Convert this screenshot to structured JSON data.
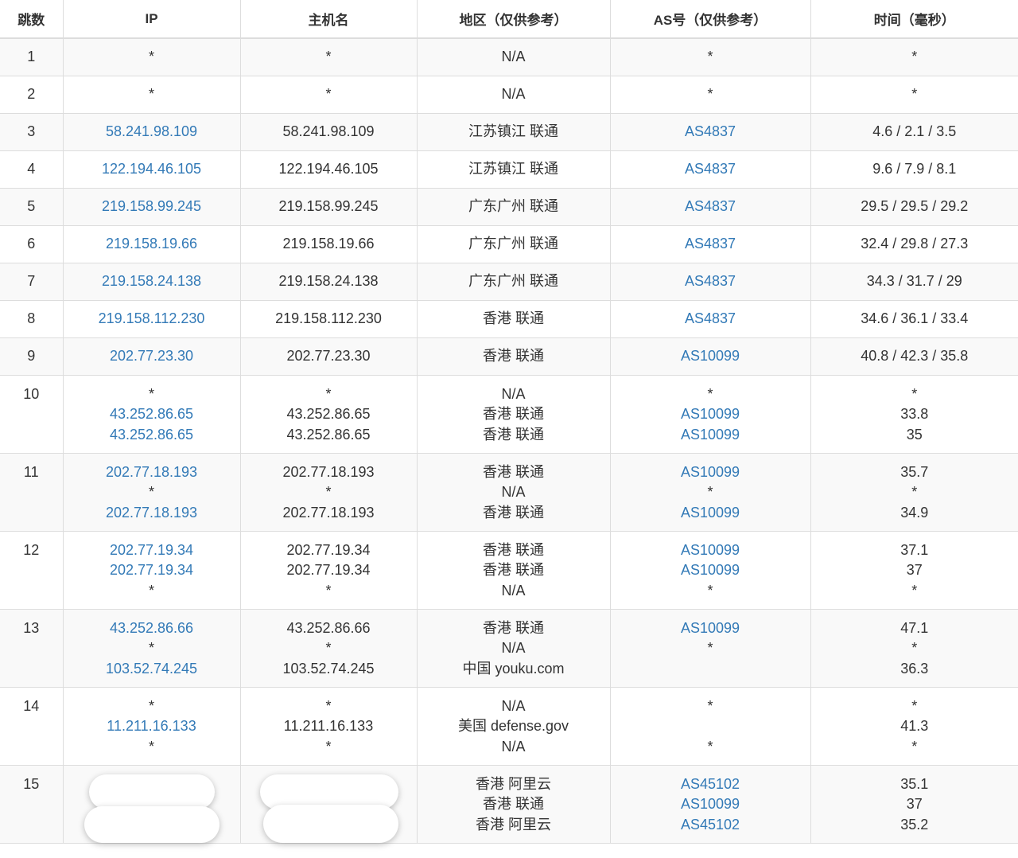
{
  "columns": {
    "hop": "跳数",
    "ip": "IP",
    "host": "主机名",
    "region": "地区（仅供参考）",
    "as": "AS号（仅供参考）",
    "time": "时间（毫秒）"
  },
  "rows": [
    {
      "hop": "1",
      "ip": [
        "*"
      ],
      "host": [
        "*"
      ],
      "region": [
        "N/A"
      ],
      "as": [
        "*"
      ],
      "time": [
        "*"
      ]
    },
    {
      "hop": "2",
      "ip": [
        "*"
      ],
      "host": [
        "*"
      ],
      "region": [
        "N/A"
      ],
      "as": [
        "*"
      ],
      "time": [
        "*"
      ]
    },
    {
      "hop": "3",
      "ip": [
        "58.241.98.109"
      ],
      "host": [
        "58.241.98.109"
      ],
      "region": [
        "江苏镇江 联通"
      ],
      "as": [
        "AS4837"
      ],
      "time": [
        "4.6 / 2.1 / 3.5"
      ]
    },
    {
      "hop": "4",
      "ip": [
        "122.194.46.105"
      ],
      "host": [
        "122.194.46.105"
      ],
      "region": [
        "江苏镇江 联通"
      ],
      "as": [
        "AS4837"
      ],
      "time": [
        "9.6 / 7.9 / 8.1"
      ]
    },
    {
      "hop": "5",
      "ip": [
        "219.158.99.245"
      ],
      "host": [
        "219.158.99.245"
      ],
      "region": [
        "广东广州 联通"
      ],
      "as": [
        "AS4837"
      ],
      "time": [
        "29.5 / 29.5 / 29.2"
      ]
    },
    {
      "hop": "6",
      "ip": [
        "219.158.19.66"
      ],
      "host": [
        "219.158.19.66"
      ],
      "region": [
        "广东广州 联通"
      ],
      "as": [
        "AS4837"
      ],
      "time": [
        "32.4 / 29.8 / 27.3"
      ]
    },
    {
      "hop": "7",
      "ip": [
        "219.158.24.138"
      ],
      "host": [
        "219.158.24.138"
      ],
      "region": [
        "广东广州 联通"
      ],
      "as": [
        "AS4837"
      ],
      "time": [
        "34.3 / 31.7 / 29"
      ]
    },
    {
      "hop": "8",
      "ip": [
        "219.158.112.230"
      ],
      "host": [
        "219.158.112.230"
      ],
      "region": [
        "香港 联通"
      ],
      "as": [
        "AS4837"
      ],
      "time": [
        "34.6 / 36.1 / 33.4"
      ]
    },
    {
      "hop": "9",
      "ip": [
        "202.77.23.30"
      ],
      "host": [
        "202.77.23.30"
      ],
      "region": [
        "香港 联通"
      ],
      "as": [
        "AS10099"
      ],
      "time": [
        "40.8 / 42.3 / 35.8"
      ]
    },
    {
      "hop": "10",
      "ip": [
        "*",
        "43.252.86.65",
        "43.252.86.65"
      ],
      "host": [
        "*",
        "43.252.86.65",
        "43.252.86.65"
      ],
      "region": [
        "N/A",
        "香港 联通",
        "香港 联通"
      ],
      "as": [
        "*",
        "AS10099",
        "AS10099"
      ],
      "time": [
        "*",
        "33.8",
        "35"
      ]
    },
    {
      "hop": "11",
      "ip": [
        "202.77.18.193",
        "*",
        "202.77.18.193"
      ],
      "host": [
        "202.77.18.193",
        "*",
        "202.77.18.193"
      ],
      "region": [
        "香港 联通",
        "N/A",
        "香港 联通"
      ],
      "as": [
        "AS10099",
        "*",
        "AS10099"
      ],
      "time": [
        "35.7",
        "*",
        "34.9"
      ]
    },
    {
      "hop": "12",
      "ip": [
        "202.77.19.34",
        "202.77.19.34",
        "*"
      ],
      "host": [
        "202.77.19.34",
        "202.77.19.34",
        "*"
      ],
      "region": [
        "香港 联通",
        "香港 联通",
        "N/A"
      ],
      "as": [
        "AS10099",
        "AS10099",
        "*"
      ],
      "time": [
        "37.1",
        "37",
        "*"
      ]
    },
    {
      "hop": "13",
      "ip": [
        "43.252.86.66",
        "*",
        "103.52.74.245"
      ],
      "host": [
        "43.252.86.66",
        "*",
        "103.52.74.245"
      ],
      "region": [
        "香港 联通",
        "N/A",
        "中国 youku.com"
      ],
      "as": [
        "AS10099",
        "*",
        ""
      ],
      "time": [
        "47.1",
        "*",
        "36.3"
      ]
    },
    {
      "hop": "14",
      "ip": [
        "*",
        "11.211.16.133",
        "*"
      ],
      "host": [
        "*",
        "11.211.16.133",
        "*"
      ],
      "region": [
        "N/A",
        "美国 defense.gov",
        "N/A"
      ],
      "as": [
        "*",
        "",
        "*"
      ],
      "time": [
        "*",
        "41.3",
        "*"
      ]
    },
    {
      "hop": "15",
      "ip": [],
      "host": [],
      "region": [
        "香港 阿里云",
        "香港 联通",
        "香港 阿里云"
      ],
      "as": [
        "AS45102",
        "AS10099",
        "AS45102"
      ],
      "time": [
        "35.1",
        "37",
        "35.2"
      ],
      "redacted": true
    }
  ]
}
